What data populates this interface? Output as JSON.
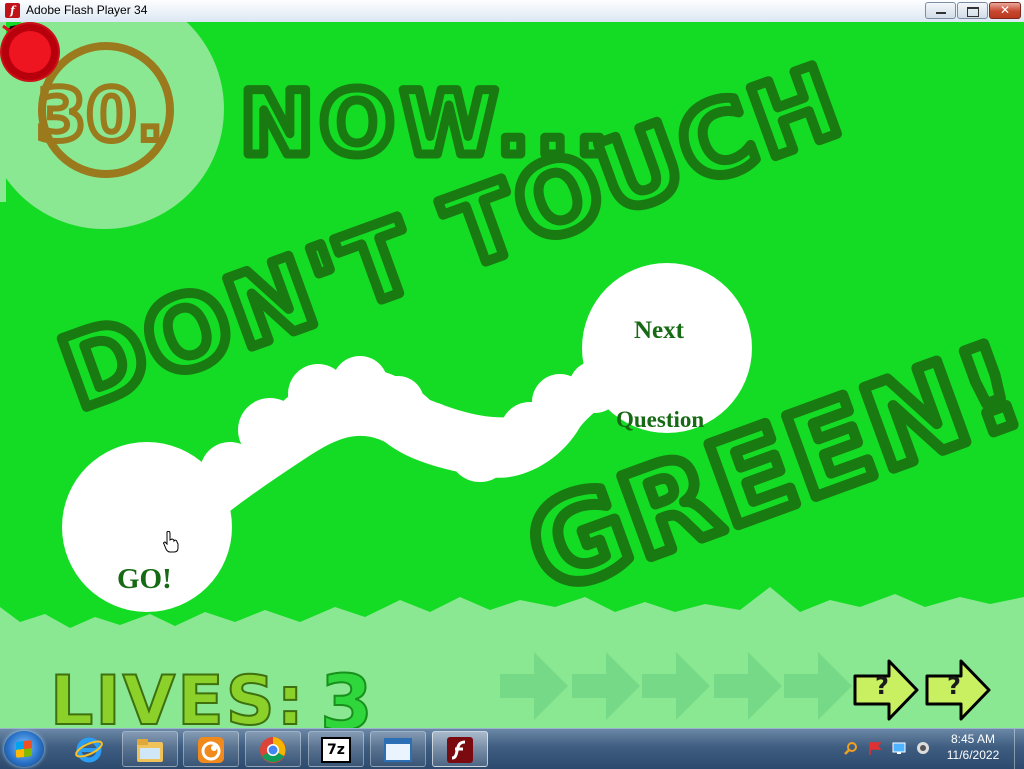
{
  "window": {
    "title": "Adobe Flash Player 34",
    "minimize_label": "",
    "restore_label": "",
    "close_label": "✕"
  },
  "game": {
    "level_number": "30.",
    "headline_line1": "NOW...",
    "headline_line2": "DON'T TOUCH",
    "headline_line3": "GREEN!",
    "go_label": "GO!",
    "next_label": "Next",
    "question_label": "Question",
    "lives_label": "LIVES:",
    "lives_value": "3",
    "skip_arrows": [
      {
        "mark": "?",
        "state": "available"
      },
      {
        "mark": "?",
        "state": "available"
      }
    ],
    "used_arrow_count": 5,
    "colors": {
      "background": "#14dc24",
      "path": "#ffffff",
      "text_dark_green": "#1a7a12",
      "level_badge": "#9a7a1c",
      "lives_text": "#8cd12a",
      "go_button_ring": "#cc0f18",
      "go_button_fill": "#3fd94a",
      "next_button": "#e0101a",
      "skip_arrow": "#c8f060"
    },
    "music_icon": "music-muted-icon"
  },
  "taskbar": {
    "pinned_apps": [
      {
        "name": "internet-explorer-icon"
      },
      {
        "name": "file-explorer-icon"
      },
      {
        "name": "uc-browser-icon"
      },
      {
        "name": "chrome-icon"
      },
      {
        "name": "7zip-icon",
        "label": "7z"
      },
      {
        "name": "window-app-icon"
      },
      {
        "name": "flash-player-icon"
      }
    ],
    "clock_time": "8:45 AM",
    "clock_date": "11/6/2022"
  }
}
